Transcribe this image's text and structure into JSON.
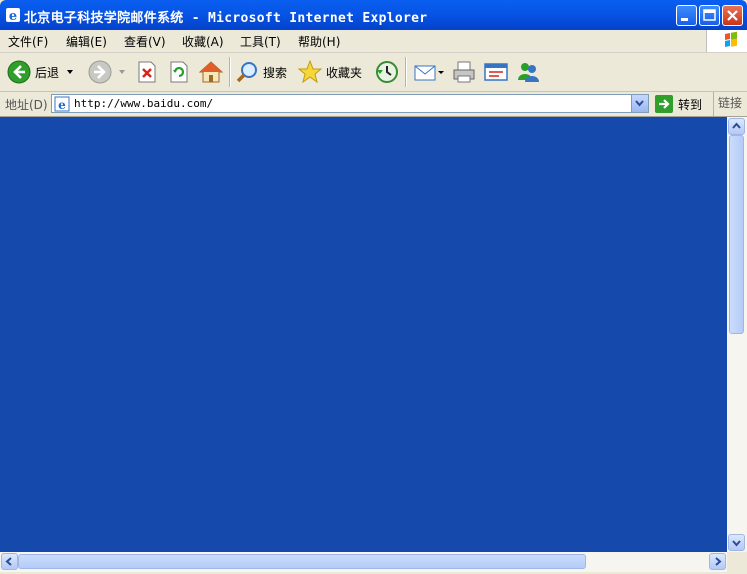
{
  "window": {
    "title": "北京电子科技学院邮件系统 - Microsoft Internet Explorer"
  },
  "menu": {
    "items": [
      {
        "label": "文件(F)"
      },
      {
        "label": "编辑(E)"
      },
      {
        "label": "查看(V)"
      },
      {
        "label": "收藏(A)"
      },
      {
        "label": "工具(T)"
      },
      {
        "label": "帮助(H)"
      }
    ]
  },
  "toolbar": {
    "back_label": "后退",
    "search_label": "搜索",
    "favorites_label": "收藏夹"
  },
  "address": {
    "label": "地址(D)",
    "url": "http://www.baidu.com/",
    "go_label": "转到",
    "links_label": "链接"
  },
  "colors": {
    "content_bg": "#154aac",
    "titlebar": "#0754e6"
  },
  "icons": [
    "ie-icon",
    "minimize-icon",
    "maximize-icon",
    "close-icon",
    "windows-logo-icon",
    "back-icon",
    "forward-icon",
    "stop-icon",
    "refresh-icon",
    "home-icon",
    "search-icon",
    "favorites-star-icon",
    "history-icon",
    "mail-icon",
    "print-icon",
    "edit-icon",
    "messenger-icon",
    "page-icon",
    "go-arrow-icon"
  ]
}
